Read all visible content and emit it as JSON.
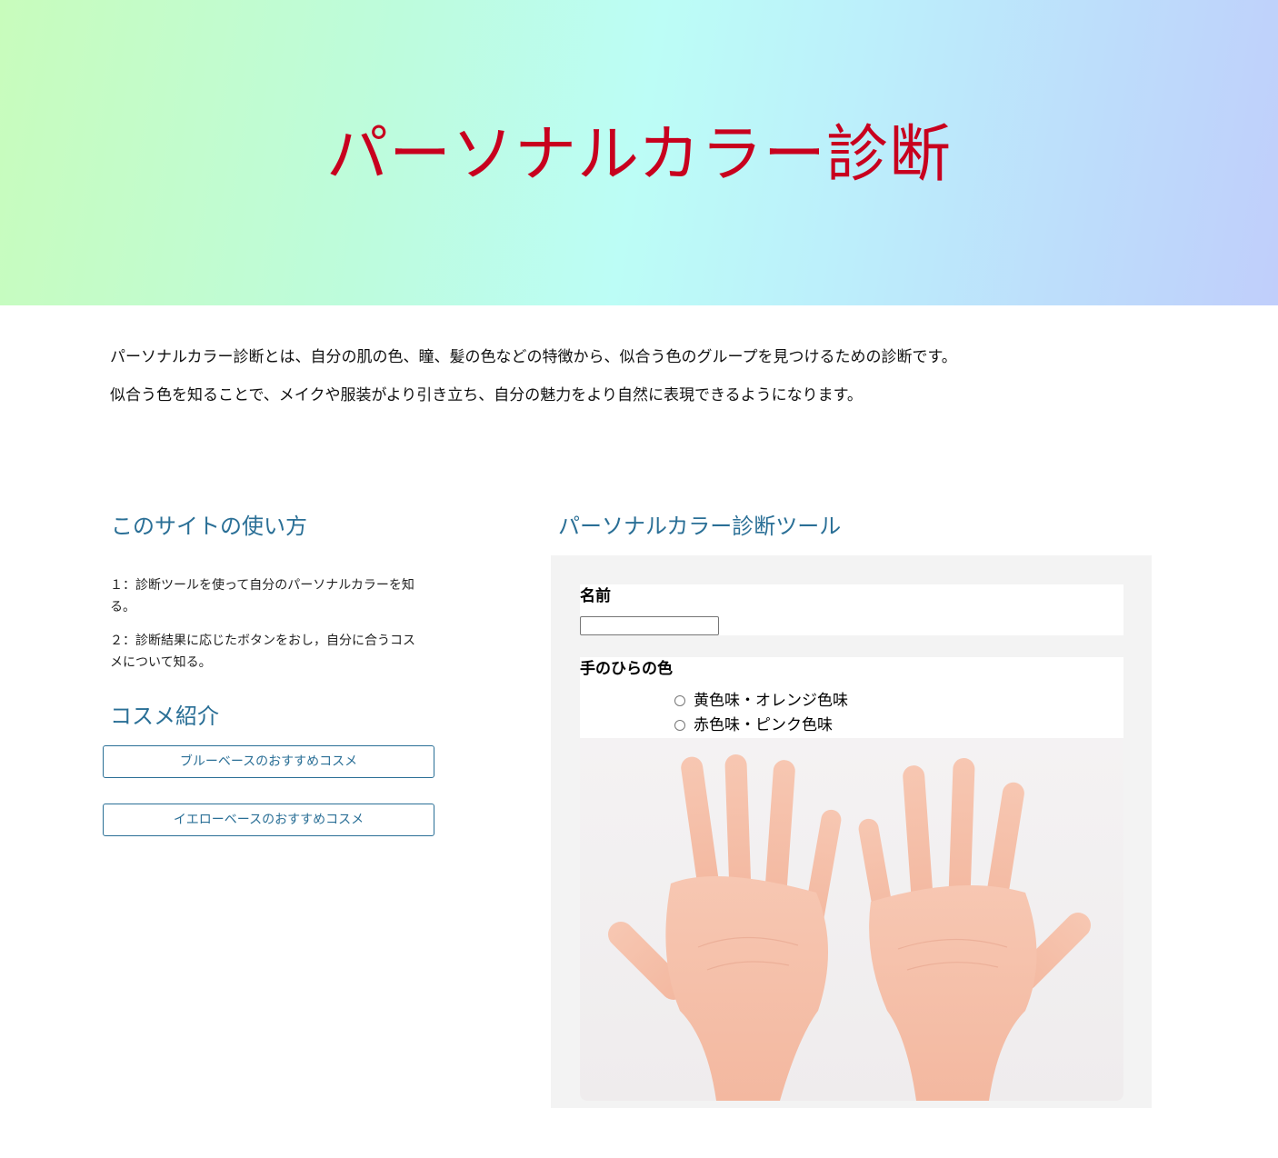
{
  "hero": {
    "title": "パーソナルカラー診断"
  },
  "intro": {
    "paragraphs": [
      "パーソナルカラー診断とは、自分の肌の色、瞳、髪の色などの特徴から、似合う色のグループを見つけるための診断です。",
      "似合う色を知ることで、メイクや服装がより引き立ち、自分の魅力をより自然に表現できるようになります。"
    ]
  },
  "usage": {
    "heading": "このサイトの使い方",
    "steps": [
      "１：診断ツールを使って自分のパーソナルカラーを知る。",
      "２：診断結果に応じたボタンをおし，自分に合うコスメについて知る。"
    ]
  },
  "cosme": {
    "heading": "コスメ紹介",
    "buttons": [
      "ブルーベースのおすすめコスメ",
      "イエローベースのおすすめコスメ"
    ]
  },
  "tool": {
    "heading": "パーソナルカラー診断ツール",
    "name_label": "名前",
    "name_value": "",
    "palm_label": "手のひらの色",
    "palm_options": [
      "黄色味・オレンジ色味",
      "赤色味・ピンク色味"
    ]
  },
  "colors": {
    "hero_title": "#c8001e",
    "heading": "#2a6f96",
    "panel_bg": "#f3f3f3"
  }
}
